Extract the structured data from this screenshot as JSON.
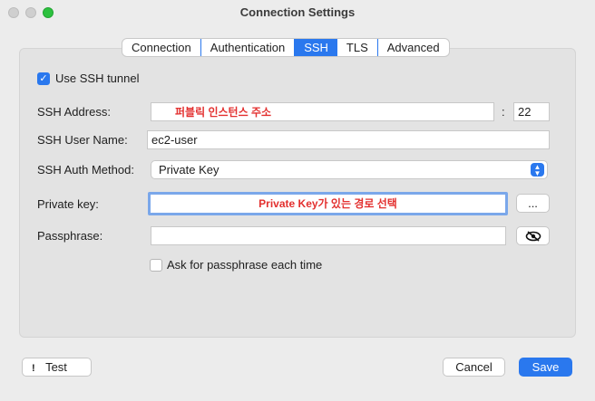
{
  "window": {
    "title": "Connection Settings"
  },
  "tabs": [
    {
      "label": "Connection"
    },
    {
      "label": "Authentication"
    },
    {
      "label": "SSH"
    },
    {
      "label": "TLS"
    },
    {
      "label": "Advanced"
    }
  ],
  "ssh": {
    "use_tunnel_label": "Use SSH tunnel",
    "use_tunnel_checked": true,
    "address_label": "SSH Address:",
    "address_annotation": "퍼블릭 인스턴스 주소",
    "port_separator": ":",
    "port_value": "22",
    "user_label": "SSH User Name:",
    "user_value": "ec2-user",
    "auth_method_label": "SSH Auth Method:",
    "auth_method_value": "Private Key",
    "private_key_label": "Private key:",
    "private_key_annotation": "Private Key가 있는 경로 선택",
    "browse_label": "...",
    "passphrase_label": "Passphrase:",
    "passphrase_value": "",
    "ask_passphrase_label": "Ask for passphrase each time",
    "ask_passphrase_checked": false
  },
  "footer": {
    "test_icon": "!",
    "test_label": "Test",
    "cancel_label": "Cancel",
    "save_label": "Save"
  },
  "colors": {
    "accent": "#2a78ee",
    "annotation": "#e3302f"
  }
}
